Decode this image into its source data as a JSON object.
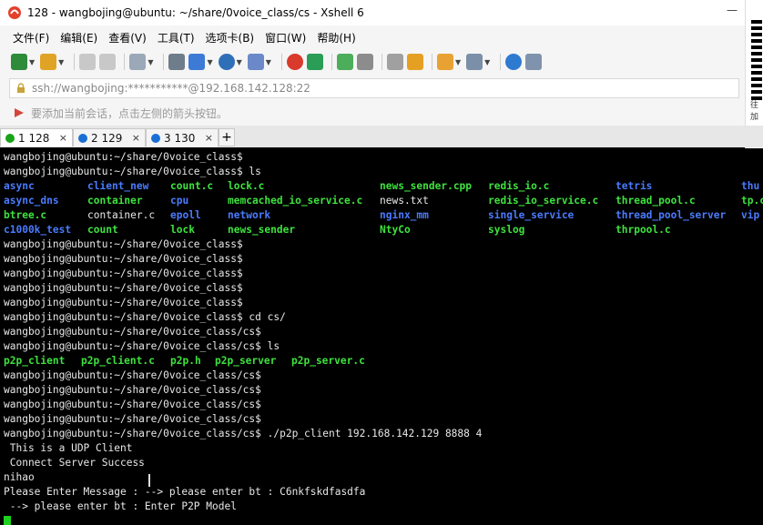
{
  "window": {
    "title": "128 - wangbojing@ubuntu: ~/share/0voice_class/cs - Xshell 6",
    "minimize": "—"
  },
  "side": {
    "text1": "往",
    "text2": "加"
  },
  "menu": [
    "文件(F)",
    "编辑(E)",
    "查看(V)",
    "工具(T)",
    "选项卡(B)",
    "窗口(W)",
    "帮助(H)"
  ],
  "address": {
    "url": "ssh://wangbojing:***********@192.168.142.128:22"
  },
  "hint": {
    "text": "要添加当前会话，点击左侧的箭头按钮。"
  },
  "tabs": [
    {
      "label": "1 128",
      "close": "×"
    },
    {
      "label": "2 129",
      "close": "×"
    },
    {
      "label": "3 130",
      "close": "×"
    }
  ],
  "tab_add": "+",
  "colors": {
    "directory": "#4a7bff",
    "executable": "#3ee23e",
    "text": "#e8e8e8",
    "tab_active_dot": "#19a319",
    "tab_dot": "#1a6fd6"
  },
  "terminal": {
    "lines": [
      "wangbojing@ubuntu:~/share/0voice_class$",
      "wangbojing@ubuntu:~/share/0voice_class$ ls",
      "wangbojing@ubuntu:~/share/0voice_class$",
      "wangbojing@ubuntu:~/share/0voice_class$",
      "wangbojing@ubuntu:~/share/0voice_class$",
      "wangbojing@ubuntu:~/share/0voice_class$",
      "wangbojing@ubuntu:~/share/0voice_class$",
      "wangbojing@ubuntu:~/share/0voice_class$ cd cs/",
      "wangbojing@ubuntu:~/share/0voice_class/cs$",
      "wangbojing@ubuntu:~/share/0voice_class/cs$ ls",
      "wangbojing@ubuntu:~/share/0voice_class/cs$",
      "wangbojing@ubuntu:~/share/0voice_class/cs$",
      "wangbojing@ubuntu:~/share/0voice_class/cs$",
      "wangbojing@ubuntu:~/share/0voice_class/cs$",
      "wangbojing@ubuntu:~/share/0voice_class/cs$ ./p2p_client 192.168.142.129 8888 4",
      " This is a UDP Client",
      " Connect Server Success",
      "nihao",
      "Please Enter Message : --> please enter bt : C6nkfskdfasdfa",
      " --> please enter bt : Enter P2P Model"
    ],
    "ls_main": [
      [
        "async",
        "client_new",
        "count.c",
        "lock.c",
        "news_sender.cpp",
        "redis_io.c",
        "tetris",
        "thu"
      ],
      [
        "async_dns",
        "container",
        "cpu",
        "memcached_io_service.c",
        "news.txt",
        "redis_io_service.c",
        "thread_pool.c",
        "tp.c"
      ],
      [
        "btree.c",
        "container.c",
        "epoll",
        "network",
        "nginx_mm",
        "single_service",
        "thread_pool_server",
        "vip"
      ],
      [
        "c1000k_test",
        "count",
        "lock",
        "news_sender",
        "NtyCo",
        "syslog",
        "thrpool.c",
        ""
      ]
    ],
    "ls_cs": [
      "p2p_client",
      "p2p_client.c",
      "p2p.h",
      "p2p_server",
      "p2p_server.c"
    ]
  }
}
